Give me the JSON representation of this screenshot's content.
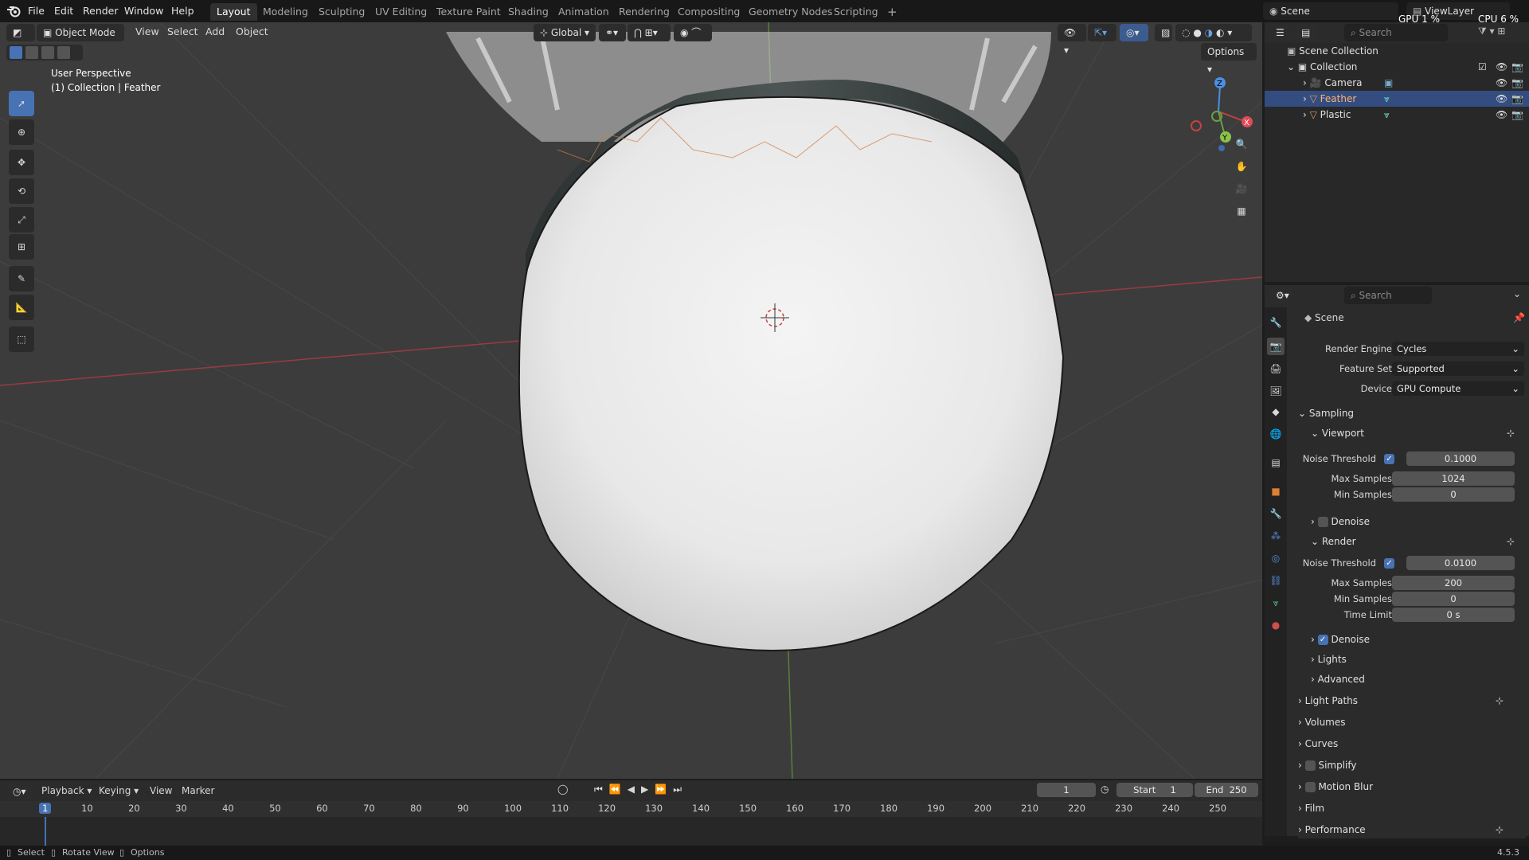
{
  "menubar": {
    "items": [
      "File",
      "Edit",
      "Render",
      "Window",
      "Help"
    ],
    "workspaces": [
      "Layout",
      "Modeling",
      "Sculpting",
      "UV Editing",
      "Texture Paint",
      "Shading",
      "Animation",
      "Rendering",
      "Compositing",
      "Geometry Nodes",
      "Scripting"
    ],
    "active_workspace": "Layout",
    "add_tab": "+",
    "scene": "Scene",
    "view_layer": "ViewLayer",
    "gpu_stat": "GPU 1 %",
    "cpu_stat": "CPU 6 %"
  },
  "viewport": {
    "mode": "Object Mode",
    "menus": [
      "View",
      "Select",
      "Add",
      "Object"
    ],
    "orientation": "Global",
    "options_label": "Options",
    "overlay_line1": "User Perspective",
    "overlay_line2": "(1) Collection | Feather",
    "gizmo_axes": {
      "x": "X",
      "y": "Y",
      "z": "Z"
    }
  },
  "outliner": {
    "search_placeholder": "Search",
    "root": "Scene Collection",
    "collection": "Collection",
    "items": [
      {
        "name": "Camera",
        "selected": false
      },
      {
        "name": "Feather",
        "selected": true
      },
      {
        "name": "Plastic",
        "selected": false
      }
    ]
  },
  "properties": {
    "search_placeholder": "Search",
    "context": "Scene",
    "render_engine_label": "Render Engine",
    "render_engine": "Cycles",
    "feature_set_label": "Feature Set",
    "feature_set": "Supported",
    "device_label": "Device",
    "device": "GPU Compute",
    "sampling": "Sampling",
    "viewport_sub": "Viewport",
    "vp_noise_label": "Noise Threshold",
    "vp_noise": "0.1000",
    "vp_max_label": "Max Samples",
    "vp_max": "1024",
    "vp_min_label": "Min Samples",
    "vp_min": "0",
    "vp_denoise": "Denoise",
    "render_sub": "Render",
    "r_noise_label": "Noise Threshold",
    "r_noise": "0.0100",
    "r_max_label": "Max Samples",
    "r_max": "200",
    "r_min_label": "Min Samples",
    "r_min": "0",
    "r_time_label": "Time Limit",
    "r_time": "0 s",
    "r_denoise": "Denoise",
    "lights": "Lights",
    "advanced": "Advanced",
    "light_paths": "Light Paths",
    "volumes": "Volumes",
    "curves": "Curves",
    "simplify": "Simplify",
    "motion_blur": "Motion Blur",
    "film": "Film",
    "performance": "Performance"
  },
  "timeline": {
    "menus": [
      "Playback",
      "Keying",
      "View",
      "Marker"
    ],
    "current_frame": "1",
    "start_label": "Start",
    "start": "1",
    "end_label": "End",
    "end": "250",
    "ruler": [
      "1",
      "10",
      "20",
      "30",
      "40",
      "50",
      "60",
      "70",
      "80",
      "90",
      "100",
      "110",
      "120",
      "130",
      "140",
      "150",
      "160",
      "170",
      "180",
      "190",
      "200",
      "210",
      "220",
      "230",
      "240",
      "250"
    ]
  },
  "statusbar": {
    "select": "Select",
    "rotate": "Rotate View",
    "options": "Options",
    "version": "4.5.3"
  },
  "colors": {
    "accent": "#4772b3",
    "selection": "#334d80",
    "x_axis": "#e14b55",
    "y_axis": "#8cc24b",
    "z_axis": "#4b8fe1"
  }
}
